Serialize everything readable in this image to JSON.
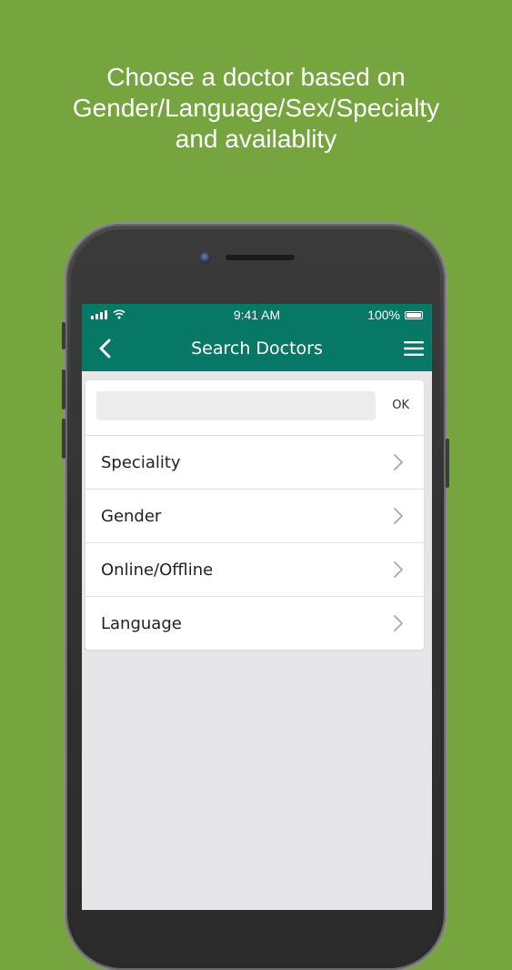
{
  "promo": {
    "lines": [
      "Choose a doctor based on",
      "Gender/Language/Sex/Specialty",
      "and availablity"
    ]
  },
  "status_bar": {
    "time": "9:41 AM",
    "battery_label": "100%",
    "battery_level": 1.0
  },
  "nav": {
    "title": "Search Doctors",
    "back_icon": "chevron-left-icon",
    "menu_icon": "hamburger-menu-icon"
  },
  "search": {
    "value": "",
    "placeholder": "",
    "ok_label": "OK"
  },
  "filters": [
    {
      "label": "Speciality"
    },
    {
      "label": "Gender"
    },
    {
      "label": "Online/Offline"
    },
    {
      "label": "Language"
    }
  ],
  "colors": {
    "background": "#76a540",
    "header": "#087866",
    "screen_bg": "#e6e6e9"
  }
}
